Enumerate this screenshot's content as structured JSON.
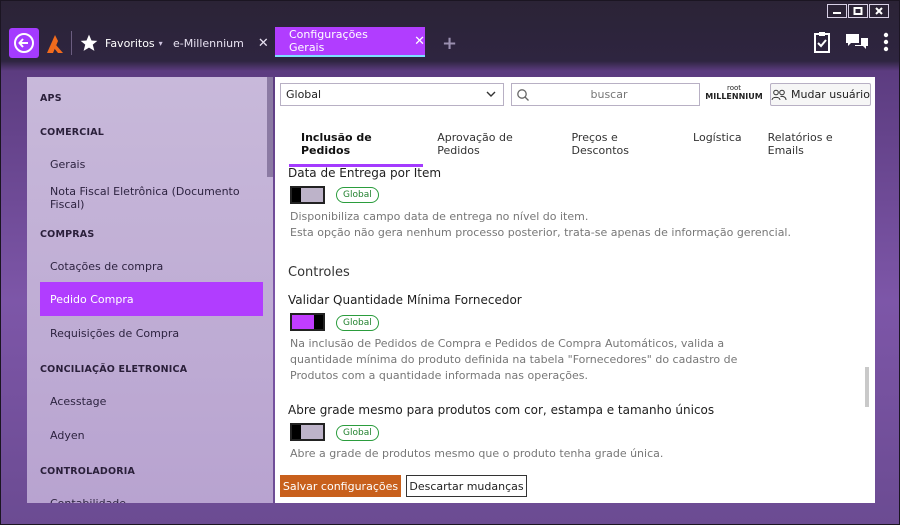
{
  "titlebar": {
    "minimize": "minimize",
    "maximize": "maximize",
    "close": "close"
  },
  "topbar": {
    "favorites_label": "Favoritos",
    "tabs": [
      {
        "label": "e-Millennium"
      },
      {
        "label": "Configurações Gerais"
      }
    ]
  },
  "sidebar": {
    "items": [
      {
        "type": "category",
        "label": "APS"
      },
      {
        "type": "category",
        "label": "COMERCIAL"
      },
      {
        "type": "item",
        "label": "Gerais"
      },
      {
        "type": "item",
        "label": "Nota Fiscal Eletrônica (Documento Fiscal)"
      },
      {
        "type": "category",
        "label": "COMPRAS"
      },
      {
        "type": "item",
        "label": "Cotações de compra"
      },
      {
        "type": "item",
        "label": "Pedido Compra",
        "active": true
      },
      {
        "type": "item",
        "label": "Requisições de Compra"
      },
      {
        "type": "category",
        "label": "CONCILIAÇÃO ELETRONICA"
      },
      {
        "type": "item",
        "label": "Acesstage"
      },
      {
        "type": "item",
        "label": "Adyen"
      },
      {
        "type": "category",
        "label": "CONTROLADORIA"
      },
      {
        "type": "item",
        "label": "Contabilidade"
      }
    ]
  },
  "filter": {
    "scope_value": "Global",
    "search_placeholder": "buscar",
    "user_line1": "root",
    "user_line2": "MILLENNIUM",
    "switch_user_label": "Mudar usuário"
  },
  "tabs": [
    {
      "label": "Inclusão de Pedidos",
      "active": true
    },
    {
      "label": "Aprovação de Pedidos"
    },
    {
      "label": "Preços e Descontos"
    },
    {
      "label": "Logística"
    },
    {
      "label": "Relatórios e Emails"
    }
  ],
  "settings": {
    "delivery_date": {
      "title": "Data de Entrega por Item",
      "badge": "Global",
      "enabled": false,
      "desc1": "Disponibiliza campo data de entrega no nível do item.",
      "desc2": "Esta opção não gera nenhum processo posterior, trata-se apenas de informação gerencial."
    },
    "section_controls": "Controles",
    "min_qty": {
      "title": "Validar Quantidade Mínima Fornecedor",
      "badge": "Global",
      "enabled": true,
      "desc1": "Na inclusão de Pedidos de Compra e Pedidos de Compra Automáticos, valida a",
      "desc2": "quantidade mínima do produto definida na tabela \"Fornecedores\" do cadastro de",
      "desc3": "Produtos com a quantidade informada nas operações."
    },
    "open_grid": {
      "title": "Abre grade mesmo para produtos com cor, estampa e tamanho únicos",
      "badge": "Global",
      "enabled": false,
      "desc1": "Abre a grade de produtos mesmo que o produto tenha grade única."
    }
  },
  "actions": {
    "save_label": "Salvar configurações",
    "discard_label": "Descartar mudanças"
  },
  "colors": {
    "accent": "#b13dff",
    "save": "#c8601c",
    "badge_green": "#2b9d3d"
  }
}
